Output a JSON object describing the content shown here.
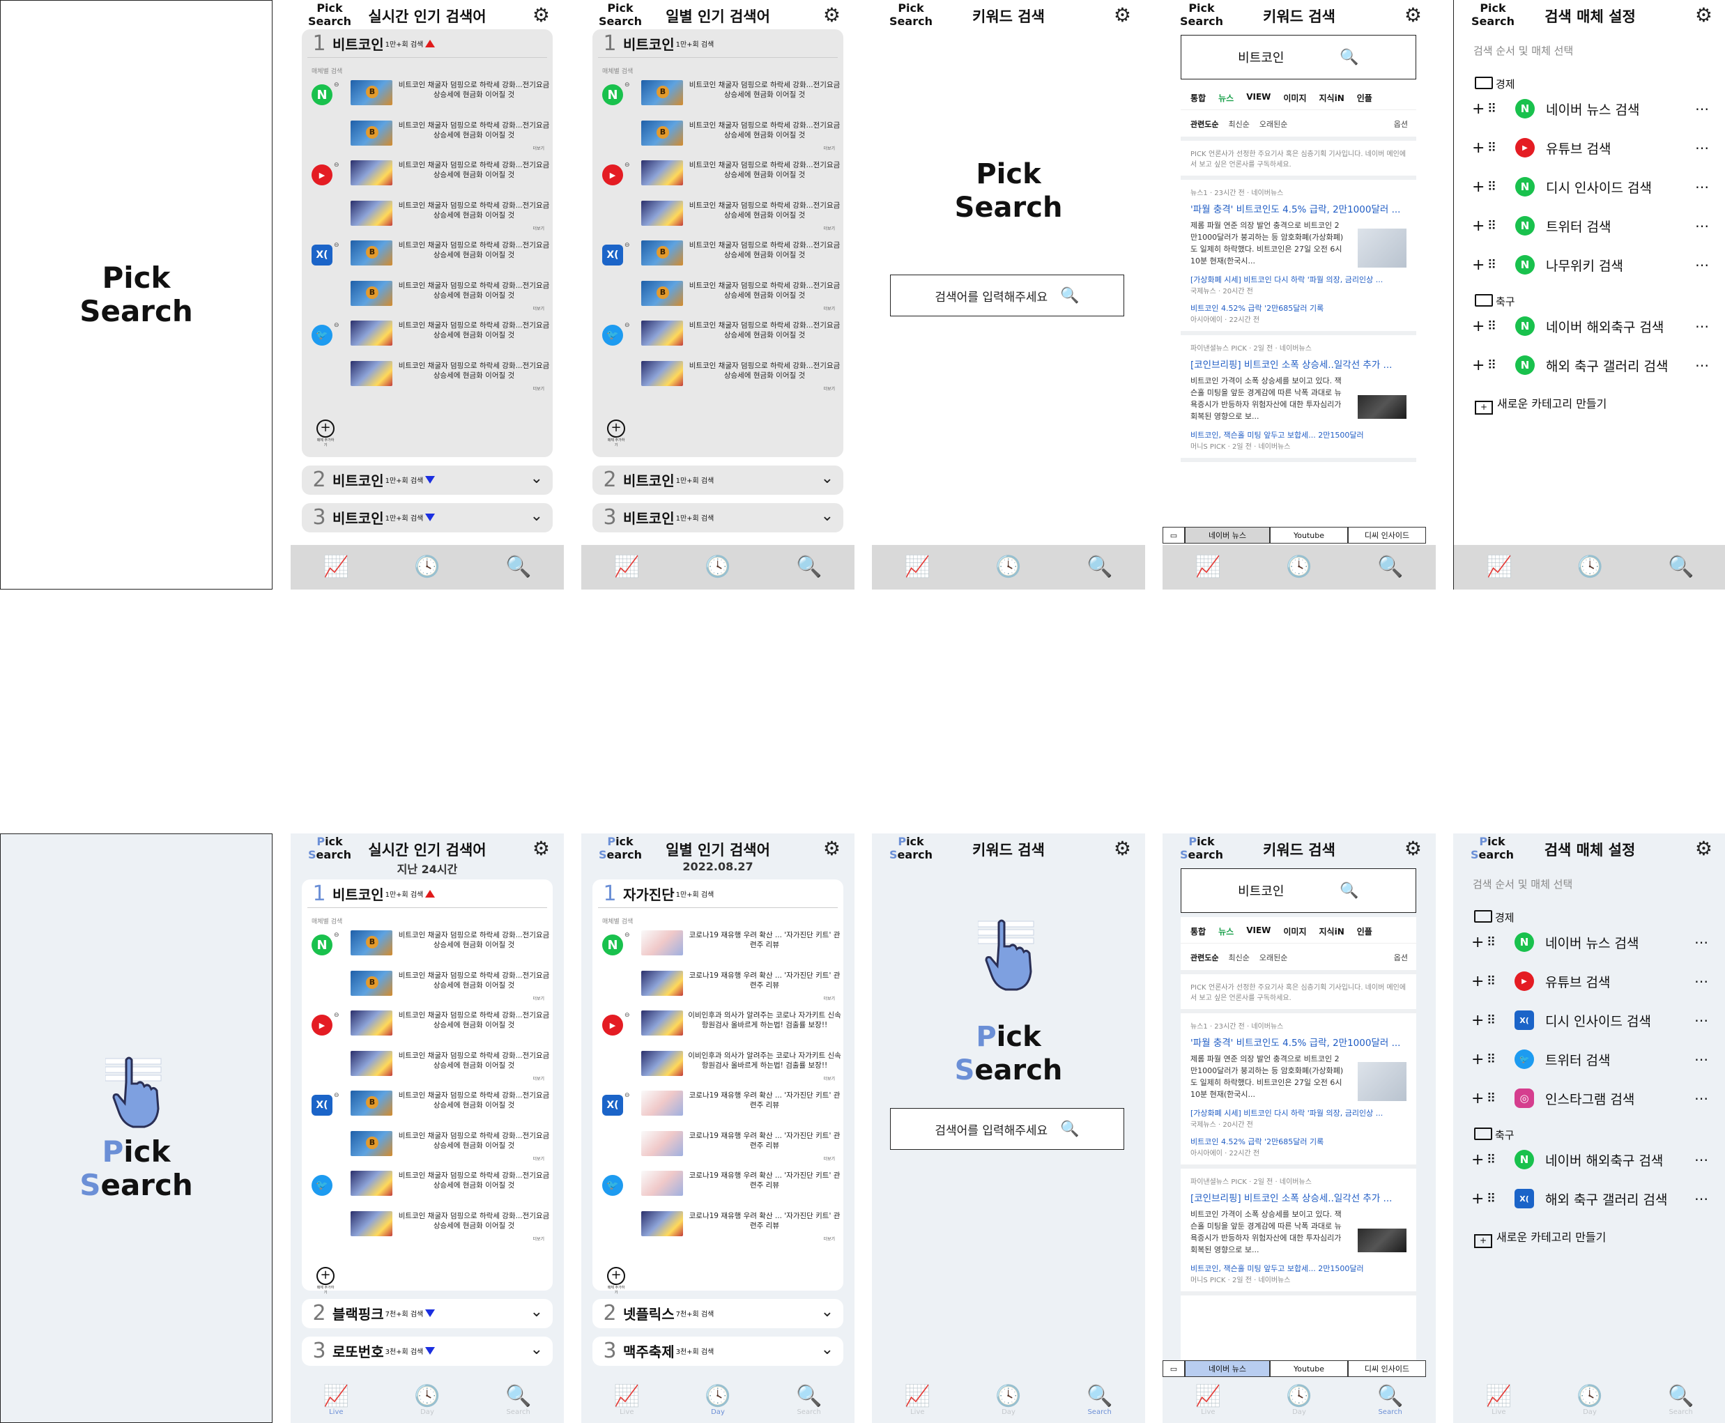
{
  "brand": {
    "logo_line1": "Pick",
    "logo_line2": "Search",
    "p": "P",
    "ick": "ick",
    "s": "S",
    "earch": "earch",
    "accent": "#6b8fd6"
  },
  "titles": {
    "realtime": "실시간 인기 검색어",
    "daily": "일별 인기 검색어",
    "keyword": "키워드 검색",
    "results": "키워드 검색",
    "settings": "검색 매체 설정",
    "last24": "지난 24시간",
    "date": "2022.08.27"
  },
  "nav": {
    "live": "Live",
    "day": "Day",
    "search": "Search"
  },
  "media_label": "매체별 검색",
  "add_media": "매체 추가하기",
  "more": "더보기",
  "news": {
    "btc": "비트코인 채굴자 덤핑으로 하락세 강화...전기요금 상승세에 현금화 이어질 것",
    "covid": "코로나19 재유행 우려 확산 ... '자가진단 키트' 관련주 리뷰",
    "doctor": "이비인후과 의사가 알려주는 코로나 자가키트 신속항원검사 올바르게 하는법! 검출률 보장!!"
  },
  "wire_ranks": [
    {
      "num": "1",
      "kw": "비트코인",
      "cnt": "1만+회 검색"
    },
    {
      "num": "2",
      "kw": "비트코인",
      "cnt": "1만+회 검색"
    },
    {
      "num": "3",
      "kw": "비트코인",
      "cnt": "1만+회 검색"
    }
  ],
  "hf_realtime_ranks": [
    {
      "num": "1",
      "kw": "비트코인",
      "cnt": "1만+회 검색"
    },
    {
      "num": "2",
      "kw": "블랙핑크",
      "cnt": "7천+회 검색"
    },
    {
      "num": "3",
      "kw": "로또번호",
      "cnt": "3천+회 검색"
    }
  ],
  "hf_daily_ranks": [
    {
      "num": "1",
      "kw": "자가진단",
      "cnt": "1만+회 검색"
    },
    {
      "num": "2",
      "kw": "넷플릭스",
      "cnt": "7천+회 검색"
    },
    {
      "num": "3",
      "kw": "맥주축제",
      "cnt": "3천+회 검색"
    }
  ],
  "search": {
    "placeholder": "검색어를 입력해주세요",
    "query": "비트코인"
  },
  "results": {
    "tabs": [
      "통합",
      "뉴스",
      "VIEW",
      "이미지",
      "지식iN",
      "인플"
    ],
    "sort": [
      "관련도순",
      "최신순",
      "오래된순",
      "옵션"
    ],
    "pick_note": "언론사가 선정한 주요기사 혹은 심층기획 기사입니다. 네이버 메인에서 보고 싶은 언론사를 구독하세요.",
    "pick_tag": "PICK",
    "n1_src": "뉴스1 · 23시간 전 · 네이버뉴스",
    "n1_head": "'파월 충격' 비트코인도 4.5% 급락, 2만1000달러 ...",
    "n1_body": "제롬 파월 연준 의장 발언 충격으로 비트코인 2만1000달러가 붕괴하는 등 암호화폐(가상화폐)도 일제히 하락했다. 비트코인은 27일 오전 6시 10분 현재(한국시...",
    "n1_link1": "[가상화폐 시세] 비트코인 다시 하락 '파월 의장, 금리인상 ...",
    "n1_link1_src": "국제뉴스 · 20시간 전",
    "n1_link2": "비트코인 4.52% 급락 '2만685달러 기록",
    "n1_link2_src": "아시아에이 · 22시간 전",
    "n2_src": "파이낸셜뉴스 PICK · 2일 전 · 네이버뉴스",
    "n2_head": "[코인브리핑] 비트코인 소폭 상승세..일각선 추가 ...",
    "n2_body": "비트코인 가격이 소폭 상승세를 보이고 있다. 잭슨홀 미팅을 앞둔 경계감에 따른 낙폭 과대로 뉴욕증시가 반등하자 위험자산에 대한 투자심리가 회복된 영향으로 보...",
    "n2_link": "비트코인, 잭슨홀 미팅 앞두고 보합세... 2만1500달러",
    "n2_link_src": "머니S PICK · 2일 전 · 네이버뉴스",
    "media_tabs": [
      "네이버 뉴스",
      "Youtube",
      "디씨 인사이드"
    ]
  },
  "settings": {
    "subtitle": "검색 순서 및 매체 선택",
    "cat_econ": "경제",
    "cat_soccer": "축구",
    "new_cat": "새로운 카테고리 만들기",
    "wire_econ": [
      "네이버 뉴스 검색",
      "유튜브 검색",
      "디시 인사이드 검색",
      "트위터 검색",
      "나무위키 검색"
    ],
    "wire_soccer": [
      "네이버 해외축구 검색",
      "해외 축구 갤러리 검색"
    ],
    "hf_econ": [
      "네이버 뉴스 검색",
      "유튜브 검색",
      "디시 인사이드 검색",
      "트위터 검색",
      "인스타그램 검색"
    ],
    "hf_soccer": [
      "네이버 해외축구 검색",
      "해외 축구 갤러리 검색"
    ]
  },
  "icons": {
    "naver": "N",
    "youtube": "▶",
    "dcinside": "X(",
    "twitter": "🐦",
    "instagram": "◎"
  },
  "colors": {
    "naver": "#19c14d",
    "youtube": "#e41c23",
    "dcinside": "#1b64c8",
    "twitter": "#1d9bf0",
    "instagram": "#d53e8e",
    "up": "#e01b1b",
    "down": "#1b2fe0"
  }
}
